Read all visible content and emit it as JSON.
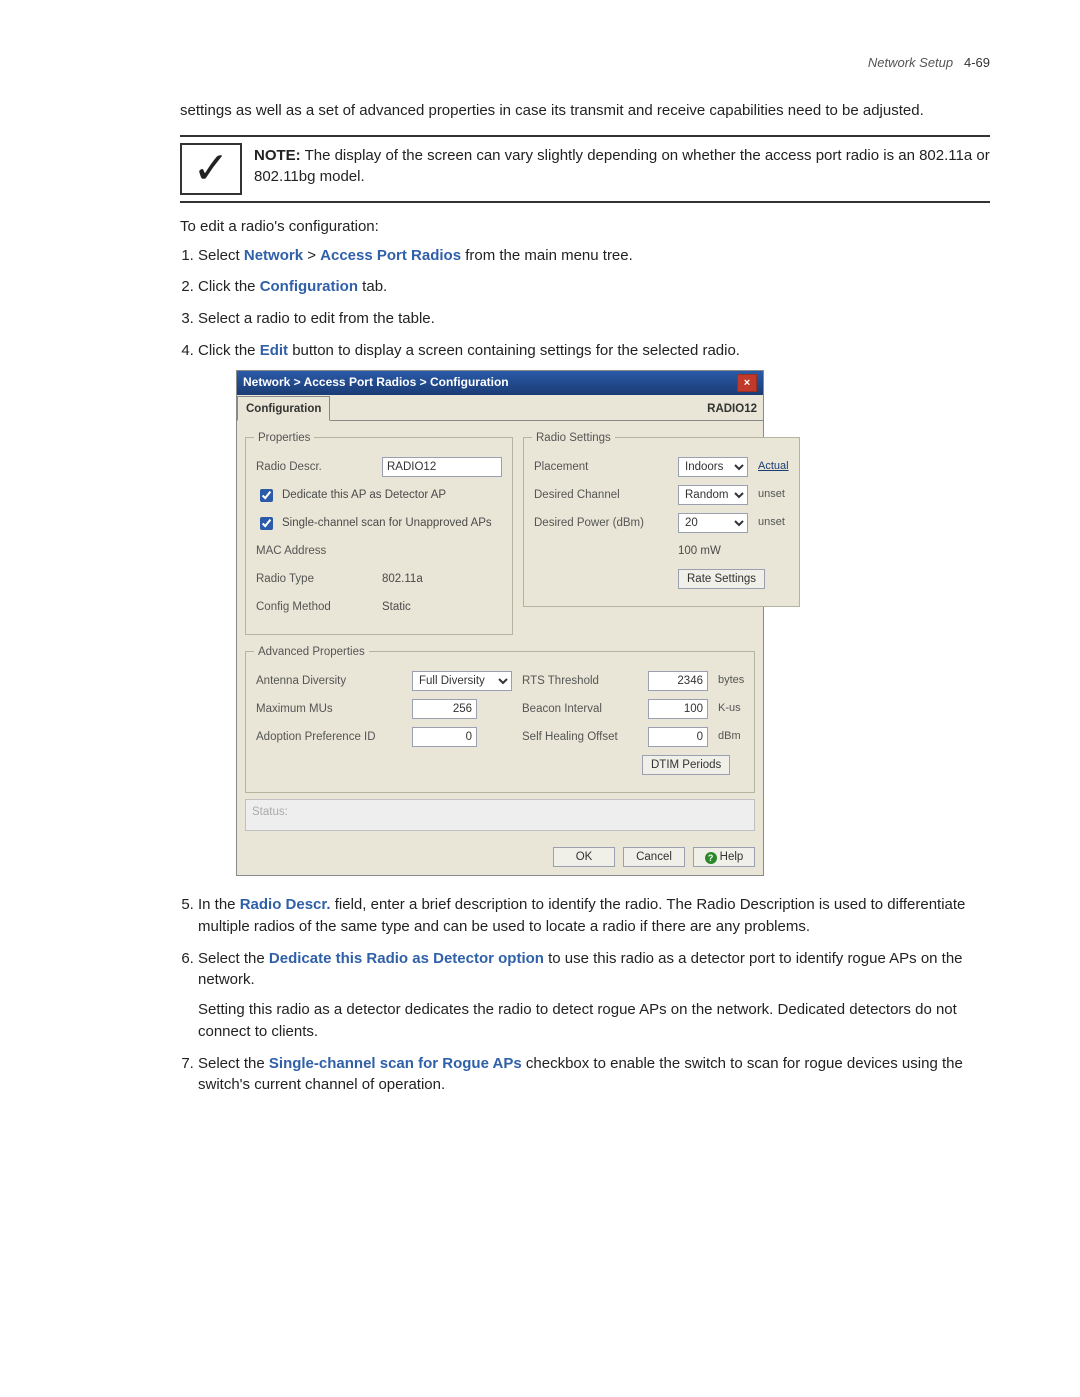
{
  "header": {
    "section": "Network Setup",
    "page_ref": "4-69"
  },
  "intro": "settings as well as a set of advanced properties in case its transmit and receive capabilities need to be adjusted.",
  "note": {
    "label": "NOTE:",
    "text": " The display of the screen can vary slightly depending on whether the access port radio is an 802.11a or 802.11bg model."
  },
  "lead": "To edit a radio's configuration:",
  "steps": {
    "s1a": "Select ",
    "s1b": "Network",
    "s1c": " > ",
    "s1d": "Access Port Radios",
    "s1e": " from the main menu tree.",
    "s2a": "Click the ",
    "s2b": "Configuration",
    "s2c": " tab.",
    "s3": "Select a radio to edit from the table.",
    "s4a": "Click the ",
    "s4b": "Edit",
    "s4c": " button to display a screen containing settings for the selected radio.",
    "s5a": "In the ",
    "s5b": "Radio Descr.",
    "s5c": " field, enter a brief description to identify the radio. The Radio Description is used to differentiate multiple radios of the same type and can be used to locate a radio if there are any problems.",
    "s6a": "Select the ",
    "s6b": "Dedicate this Radio as Detector option",
    "s6c": " to use this radio as a detector port to identify rogue APs on the network.",
    "s6d": "Setting this radio as a detector dedicates the radio to detect rogue APs on the network. Dedicated detectors do not connect to clients.",
    "s7a": "Select the ",
    "s7b": "Single-channel scan for Rogue APs",
    "s7c": " checkbox to enable the switch to scan for rogue devices using the switch's current channel of operation."
  },
  "scr": {
    "breadcrumb": "Network > Access Port Radios > Configuration",
    "tab": "Configuration",
    "radio_id": "RADIO12",
    "properties": {
      "legend": "Properties",
      "descr_label": "Radio Descr.",
      "descr_value": "RADIO12",
      "dedicate_label": "Dedicate this AP as Detector AP",
      "scan_label": "Single-channel scan for Unapproved APs",
      "mac_label": "MAC Address",
      "type_label": "Radio Type",
      "type_value": "802.11a",
      "method_label": "Config Method",
      "method_value": "Static"
    },
    "settings": {
      "legend": "Radio Settings",
      "placement_label": "Placement",
      "placement_value": "Indoors",
      "placement_link": "Actual",
      "channel_label": "Desired Channel",
      "channel_value": "Random",
      "channel_note": "unset",
      "power_label": "Desired Power (dBm)",
      "power_value": "20",
      "power_note": "unset",
      "power_mw": "100 mW",
      "rate_btn": "Rate Settings"
    },
    "advanced": {
      "legend": "Advanced Properties",
      "antenna_label": "Antenna Diversity",
      "antenna_value": "Full Diversity",
      "maxmu_label": "Maximum MUs",
      "maxmu_value": "256",
      "adopt_label": "Adoption Preference ID",
      "adopt_value": "0",
      "rts_label": "RTS Threshold",
      "rts_value": "2346",
      "rts_unit": "bytes",
      "beacon_label": "Beacon Interval",
      "beacon_value": "100",
      "beacon_unit": "K-us",
      "heal_label": "Self Healing Offset",
      "heal_value": "0",
      "heal_unit": "dBm",
      "dtim_btn": "DTIM Periods"
    },
    "status_label": "Status:",
    "ok": "OK",
    "cancel": "Cancel",
    "help": "Help"
  }
}
